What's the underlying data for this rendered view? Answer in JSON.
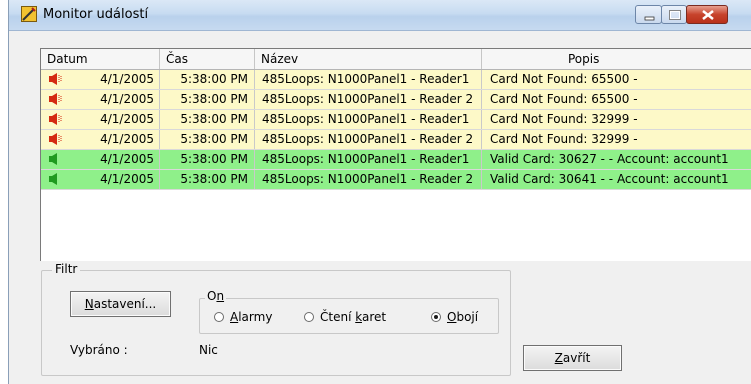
{
  "window": {
    "title": "Monitor událostí"
  },
  "grid": {
    "columns": [
      "Datum",
      "Čas",
      "Název",
      "Popis"
    ],
    "rows": [
      {
        "type": "alarm",
        "date": "4/1/2005",
        "time": "5:38:00 PM",
        "name": "485Loops: N1000Panel1 - Reader1",
        "desc": "Card Not Found: 65500 -"
      },
      {
        "type": "alarm",
        "date": "4/1/2005",
        "time": "5:38:00 PM",
        "name": "485Loops: N1000Panel1 - Reader 2",
        "desc": "Card Not Found: 65500 -"
      },
      {
        "type": "alarm",
        "date": "4/1/2005",
        "time": "5:38:00 PM",
        "name": "485Loops: N1000Panel1 - Reader1",
        "desc": "Card Not Found: 32999 -"
      },
      {
        "type": "alarm",
        "date": "4/1/2005",
        "time": "5:38:00 PM",
        "name": "485Loops: N1000Panel1 - Reader 2",
        "desc": "Card Not Found: 32999 -"
      },
      {
        "type": "valid",
        "date": "4/1/2005",
        "time": "5:38:00 PM",
        "name": "485Loops: N1000Panel1 - Reader1",
        "desc": "Valid Card: 30627 -   - Account: account1"
      },
      {
        "type": "valid",
        "date": "4/1/2005",
        "time": "5:38:00 PM",
        "name": "485Loops: N1000Panel1 - Reader 2",
        "desc": "Valid Card: 30641 -   - Account: account1"
      }
    ]
  },
  "filter": {
    "legend": "Filtr",
    "settings_button": {
      "pre": "",
      "accel": "N",
      "post": "astavení..."
    },
    "on_group": {
      "pre": "O",
      "accel": "n",
      "post": ""
    },
    "options": [
      {
        "pre": "",
        "accel": "A",
        "post": "larmy",
        "checked": false
      },
      {
        "pre": "Čtení ",
        "accel": "k",
        "post": "aret",
        "checked": false
      },
      {
        "pre": "",
        "accel": "O",
        "post": "bojí",
        "checked": true
      }
    ],
    "selected_label": "Vybráno :",
    "selected_value": "Nic"
  },
  "close_button": {
    "pre": "",
    "accel": "Z",
    "post": "avřít"
  },
  "colors": {
    "alarm_row": "#fdf9c8",
    "valid_row": "#8ff08a",
    "alarm_icon": "#d42a10",
    "valid_icon": "#1f9a1f"
  }
}
